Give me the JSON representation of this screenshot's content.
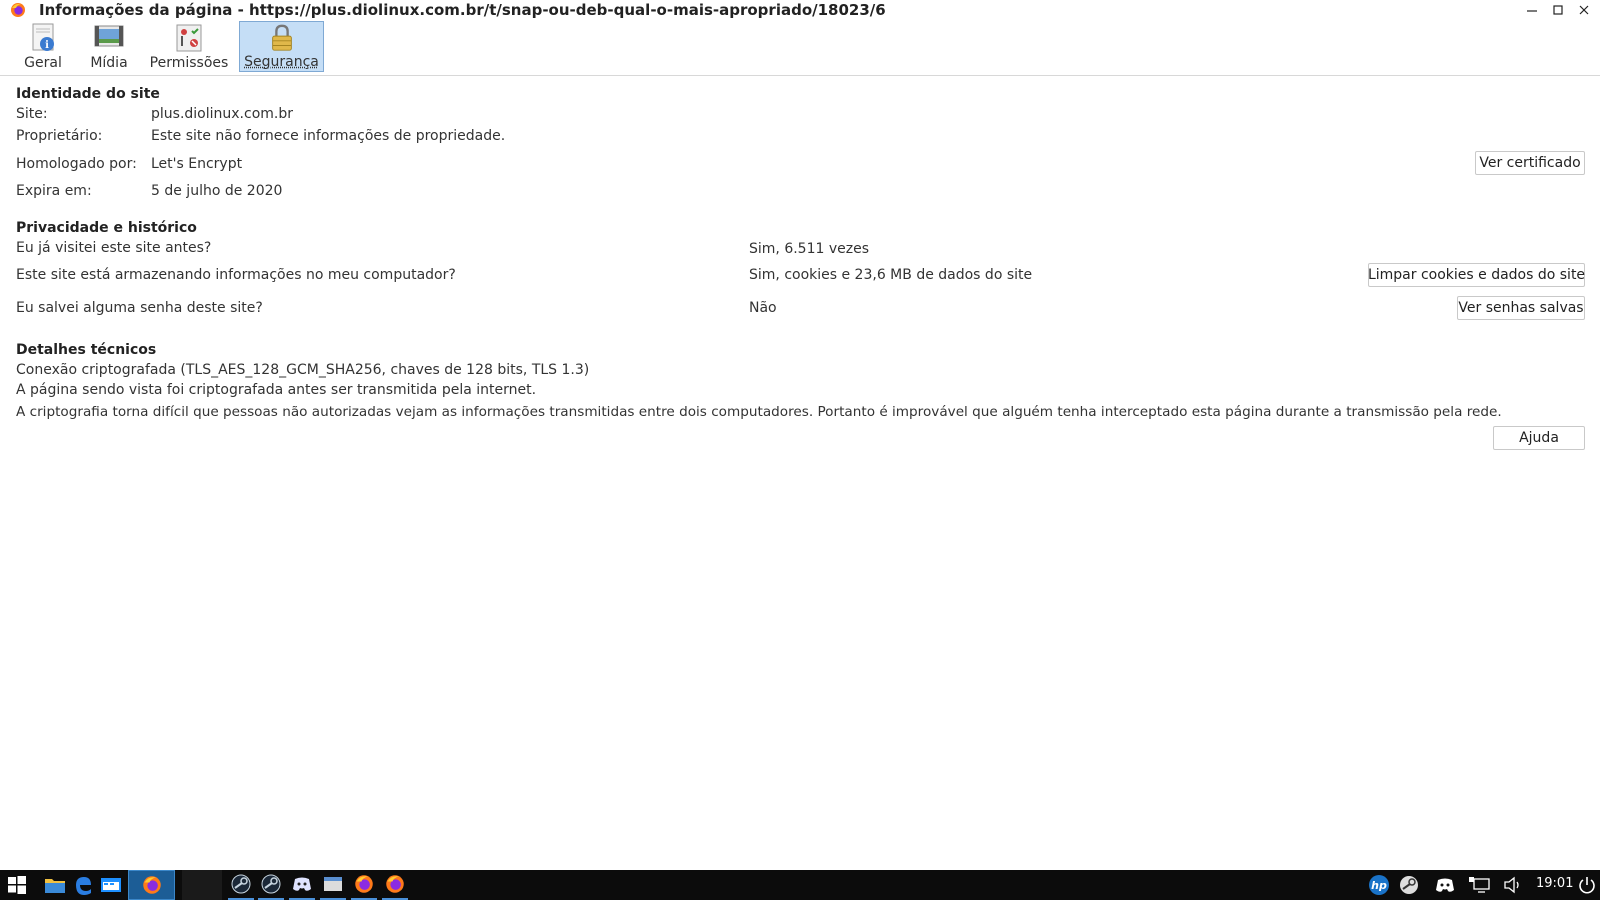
{
  "window": {
    "title": "Informações da página - https://plus.diolinux.com.br/t/snap-ou-deb-qual-o-mais-apropriado/18023/6"
  },
  "tabs": [
    {
      "label": "Geral",
      "icon": "info-document-icon"
    },
    {
      "label": "Mídia",
      "icon": "media-icon"
    },
    {
      "label": "Permissões",
      "icon": "permissions-icon"
    },
    {
      "label": "Segurança",
      "icon": "lock-icon",
      "selected": true
    }
  ],
  "identity": {
    "heading": "Identidade do site",
    "site_label": "Site:",
    "site_value": "plus.diolinux.com.br",
    "owner_label": "Proprietário:",
    "owner_value": "Este site não fornece informações de propriedade.",
    "verified_label": "Homologado por:",
    "verified_value": "Let's Encrypt",
    "expires_label": "Expira em:",
    "expires_value": "5 de julho de 2020",
    "view_cert_button": "Ver certificado"
  },
  "privacy": {
    "heading": "Privacidade e histórico",
    "visited_question": "Eu já visitei este site antes?",
    "visited_answer": "Sim, 6.511 vezes",
    "storage_question": "Este site está armazenando informações no meu computador?",
    "storage_answer": "Sim, cookies e 23,6 MB de dados do site",
    "clear_button": "Limpar cookies e dados do site",
    "password_question": "Eu salvei alguma senha deste site?",
    "password_answer": "Não",
    "passwords_button": "Ver senhas salvas"
  },
  "technical": {
    "heading": "Detalhes técnicos",
    "line1": "Conexão criptografada (TLS_AES_128_GCM_SHA256, chaves de 128 bits, TLS 1.3)",
    "line2": "A página sendo vista foi criptografada antes ser transmitida pela internet.",
    "line3": "A criptografia torna difícil que pessoas não autorizadas vejam as informações transmitidas entre dois computadores. Portanto é improvável que alguém tenha interceptado esta página durante a transmissão pela rede."
  },
  "help_button": "Ajuda",
  "taskbar": {
    "clock": "19:01",
    "items": [
      "start-icon",
      "file-manager-icon",
      "edge-browser-icon",
      "window-icon",
      "firefox-icon",
      "steam-icon",
      "steam-icon",
      "discord-icon",
      "window-icon",
      "firefox-icon",
      "firefox-icon"
    ],
    "tray": [
      "hp-icon",
      "steam-icon",
      "discord-icon",
      "network-icon",
      "volume-icon",
      "power-icon"
    ]
  },
  "colors": {
    "selected_tab_bg": "#c5def6",
    "taskbar_bg": "#0c0c0c",
    "active_task_bg": "#1c5d96"
  }
}
